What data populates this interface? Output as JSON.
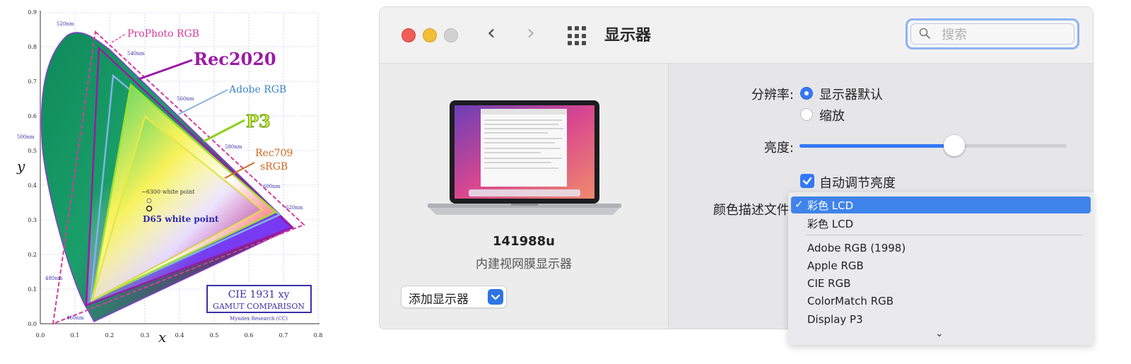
{
  "chart": {
    "gamut_labels": [
      "ProPhoto RGB",
      "Rec2020",
      "Adobe RGB",
      "P3",
      "Rec709",
      "sRGB"
    ],
    "white_points": [
      "~6300 white point",
      "D65 white point"
    ],
    "axis_x_label": "x",
    "axis_y_label": "y",
    "x_ticks": [
      "0.0",
      "0.1",
      "0.2",
      "0.3",
      "0.4",
      "0.5",
      "0.6",
      "0.7",
      "0.8"
    ],
    "y_ticks": [
      "0.0",
      "0.1",
      "0.2",
      "0.3",
      "0.4",
      "0.5",
      "0.6",
      "0.7",
      "0.8",
      "0.9"
    ],
    "wavelengths": [
      "520nm",
      "540nm",
      "560nm",
      "500nm",
      "580nm",
      "600nm",
      "620nm",
      "480nm",
      "460nm"
    ],
    "box_line1": "CIE 1931 xy",
    "box_line2": "GAMUT COMPARISON",
    "credit": "Myndex Research (CC)",
    "colors": {
      "prophoto": "#d63c9a",
      "rec2020": "#9b1aa5",
      "adobe": "#3b86c8",
      "p3": "#8bd21c",
      "rec709": "#d2691e",
      "box": "#3a2fa8"
    }
  },
  "window": {
    "title": "显示器",
    "nav_back_icon": "chevron-left-icon",
    "nav_forward_icon": "chevron-right-icon",
    "grid_icon": "grid-icon",
    "search_placeholder": "搜索",
    "display_name": "141988u",
    "display_type": "内建视网膜显示器",
    "add_display_label": "添加显示器",
    "resolution_label": "分辨率:",
    "resolution_options": [
      "显示器默认",
      "缩放"
    ],
    "resolution_selected": "显示器默认",
    "brightness_label": "亮度:",
    "brightness_value": 0.58,
    "auto_brightness_label": "自动调节亮度",
    "auto_brightness_checked": true,
    "color_profile_label": "颜色描述文件:",
    "color_profile_selected": "彩色 LCD",
    "color_profile_options": [
      "彩色 LCD",
      "Adobe RGB (1998)",
      "Apple RGB",
      "CIE RGB",
      "ColorMatch RGB",
      "Display P3"
    ],
    "accent": "#3478f6"
  }
}
